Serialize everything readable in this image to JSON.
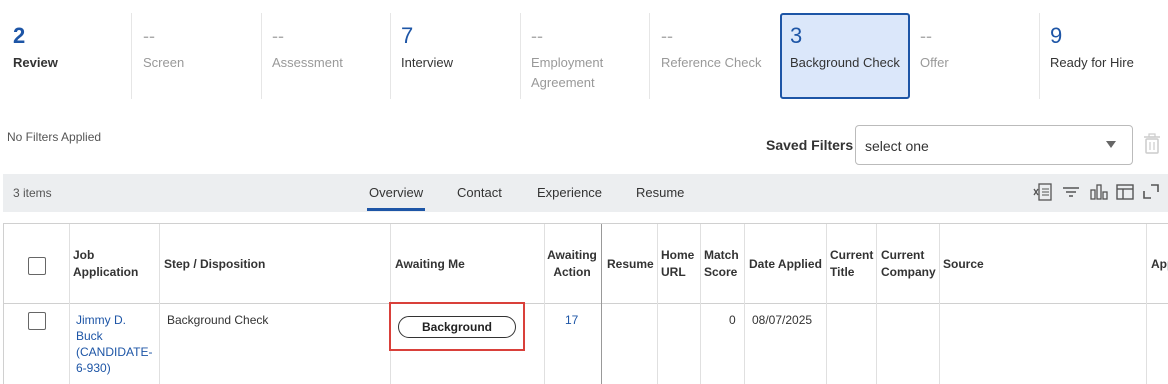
{
  "stages": [
    {
      "count": "2",
      "label": "Review"
    },
    {
      "count": "--",
      "label": "Screen"
    },
    {
      "count": "--",
      "label": "Assessment"
    },
    {
      "count": "7",
      "label": "Interview"
    },
    {
      "count": "--",
      "label": "Employment Agreement"
    },
    {
      "count": "--",
      "label": "Reference Check"
    },
    {
      "count": "3",
      "label": "Background Check"
    },
    {
      "count": "--",
      "label": "Offer"
    },
    {
      "count": "9",
      "label": "Ready for Hire"
    }
  ],
  "filters": {
    "no_filters": "No Filters Applied",
    "saved_label": "Saved Filters",
    "select_value": "select one"
  },
  "tabbar": {
    "items_count": "3 items",
    "tabs": [
      "Overview",
      "Contact",
      "Experience",
      "Resume"
    ]
  },
  "table": {
    "headers": [
      "Job Application",
      "Step / Disposition",
      "Awaiting Me",
      "Awaiting Action",
      "Resume",
      "Home URL",
      "Match Score",
      "Date Applied",
      "Current Title",
      "Current Company",
      "Source",
      "App"
    ],
    "rows": [
      {
        "job_application": "Jimmy D. Buck (CANDIDATE-6-930)",
        "step": "Background Check",
        "awaiting_me": "Background",
        "awaiting_action": "17",
        "match_score": "0",
        "date_applied": "08/07/2025"
      }
    ]
  },
  "colors": {
    "accent": "#1d55a6",
    "highlight": "#d9403a",
    "selected_bg": "#dbe7fa"
  }
}
